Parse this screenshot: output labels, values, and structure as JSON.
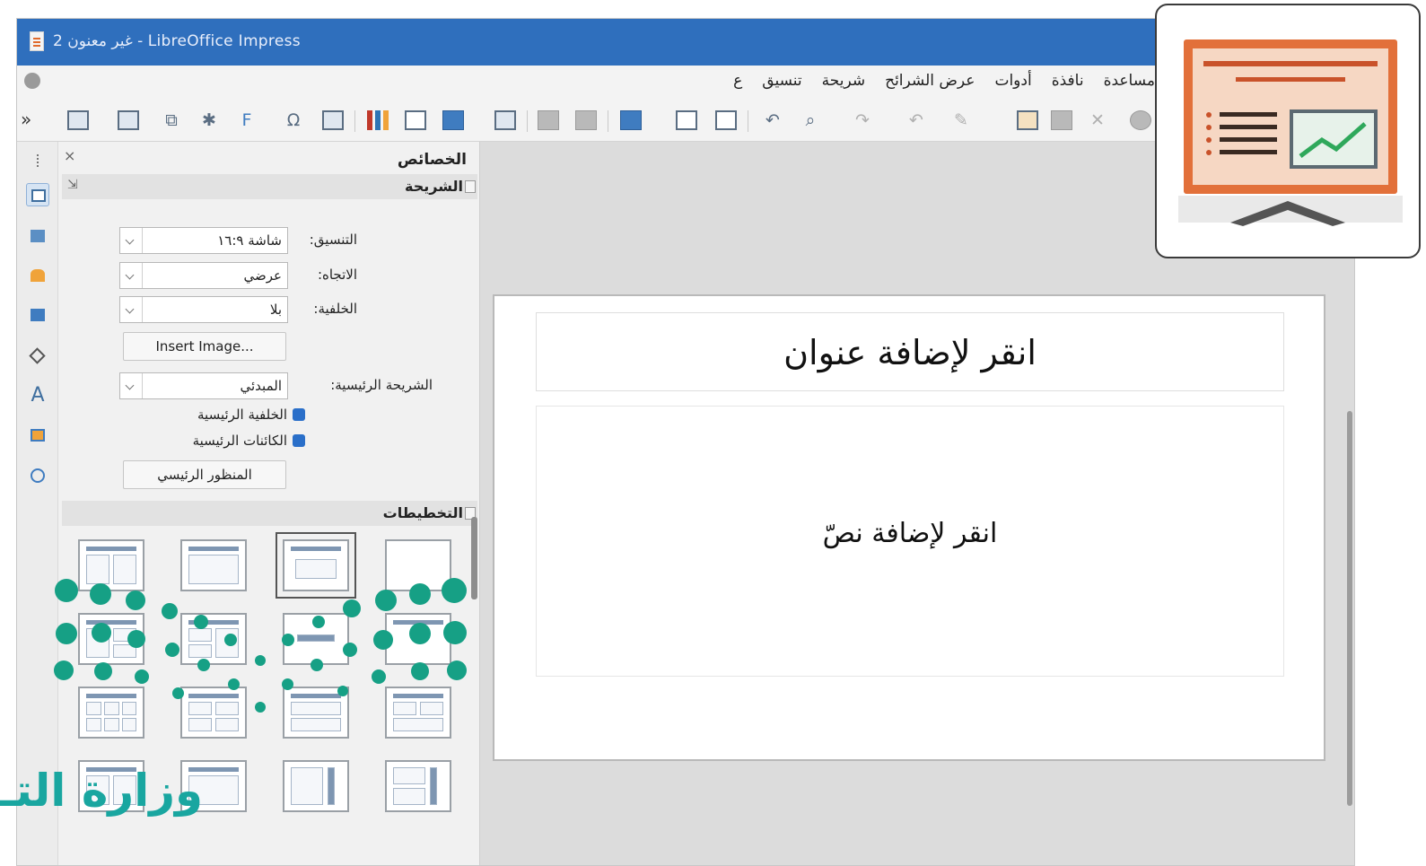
{
  "window": {
    "title": "غير معنون 2 - LibreOffice Impress"
  },
  "menu": {
    "items": [
      "ع",
      "تنسيق",
      "شريحة",
      "عرض الشرائح",
      "أدوات",
      "نافذة",
      "مساعدة"
    ]
  },
  "toolbar": {
    "more": "»",
    "icons": [
      "slide-icon",
      "open-icon",
      "save-icon",
      "chart-icon",
      "table-icon",
      "image-icon",
      "undo-icon",
      "redo-icon",
      "find-icon",
      "cut-icon",
      "copy-icon",
      "paste-icon"
    ]
  },
  "sidebar": {
    "panel_title": "الخصائص",
    "slide_section": {
      "title": "الشريحة",
      "format_label": "التنسيق:",
      "format_value": "شاشة ١٦:٩",
      "orientation_label": "الاتجاه:",
      "orientation_value": "عرضي",
      "background_label": "الخلفية:",
      "background_value": "بلا",
      "insert_image_button": "Insert Image...",
      "master_slide_label": "الشريحة الرئيسية:",
      "master_slide_value": "المبدئي",
      "master_background_check": "الخلفية الرئيسية",
      "master_objects_check": "الكائنات الرئيسية",
      "master_view_button": "المنظور الرئيسي"
    },
    "layouts_section": {
      "title": "التخطيطات"
    }
  },
  "slide": {
    "title_placeholder": "انقر لإضافة عنوان",
    "content_placeholder": "انقر لإضافة نصّ"
  },
  "watermark": {
    "text": "وزارة التـ"
  },
  "colors": {
    "title_bar": "#2f6fbd",
    "accent_dots": "#16a085",
    "logo_orange": "#e2703a"
  }
}
